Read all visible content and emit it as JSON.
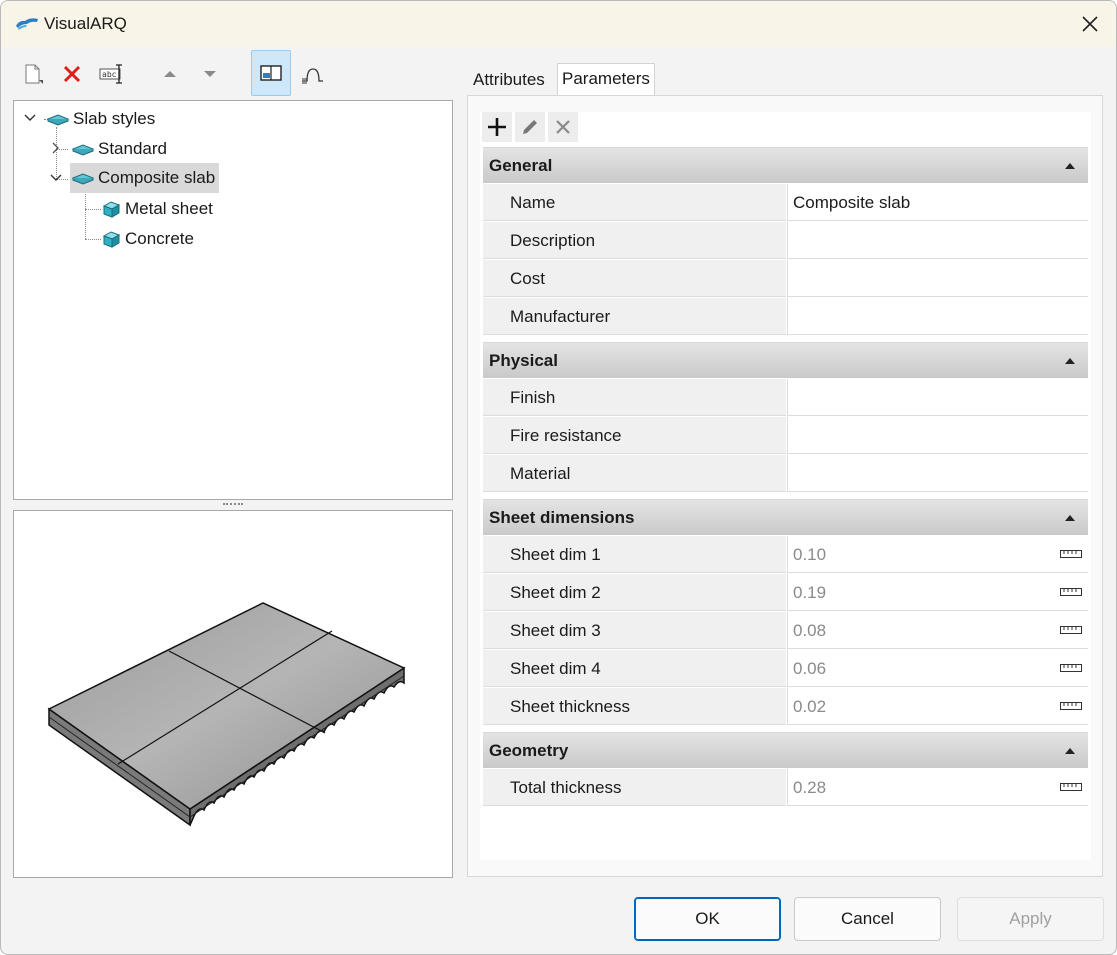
{
  "window": {
    "title": "VisualARQ"
  },
  "icons": {
    "app": "visualarq-logo-icon",
    "close": "close-icon",
    "new": "new-document-icon",
    "delete": "delete-icon",
    "rename": "rename-icon",
    "move_up": "move-up-icon",
    "move_down": "move-down-icon",
    "preview_toggle": "preview-panel-icon",
    "profile": "profile-icon"
  },
  "tree": {
    "root": "Slab styles",
    "items": [
      {
        "label": "Standard"
      },
      {
        "label": "Composite slab",
        "selected": true,
        "children": [
          "Metal sheet",
          "Concrete"
        ]
      }
    ]
  },
  "tabs": [
    "Attributes",
    "Parameters"
  ],
  "active_tab": "Parameters",
  "groups": [
    {
      "title": "General",
      "rows": [
        {
          "name": "Name",
          "value": "Composite slab"
        },
        {
          "name": "Description",
          "value": ""
        },
        {
          "name": "Cost",
          "value": ""
        },
        {
          "name": "Manufacturer",
          "value": ""
        }
      ]
    },
    {
      "title": "Physical",
      "rows": [
        {
          "name": "Finish",
          "value": ""
        },
        {
          "name": "Fire resistance",
          "value": ""
        },
        {
          "name": "Material",
          "value": ""
        }
      ]
    },
    {
      "title": "Sheet dimensions",
      "rows": [
        {
          "name": "Sheet dim 1",
          "value": "0.10"
        },
        {
          "name": "Sheet dim 2",
          "value": "0.19"
        },
        {
          "name": "Sheet dim 3",
          "value": "0.08"
        },
        {
          "name": "Sheet dim 4",
          "value": "0.06"
        },
        {
          "name": "Sheet thickness",
          "value": "0.02"
        }
      ]
    },
    {
      "title": "Geometry",
      "rows": [
        {
          "name": "Total thickness",
          "value": "0.28"
        }
      ]
    }
  ],
  "buttons": {
    "ok": "OK",
    "cancel": "Cancel",
    "apply": "Apply"
  },
  "colors": {
    "accent": "#0067c0",
    "selection": "#d9d9d9",
    "titlebar": "#f8f4e8",
    "tree_icon": "#5ec8d8"
  }
}
